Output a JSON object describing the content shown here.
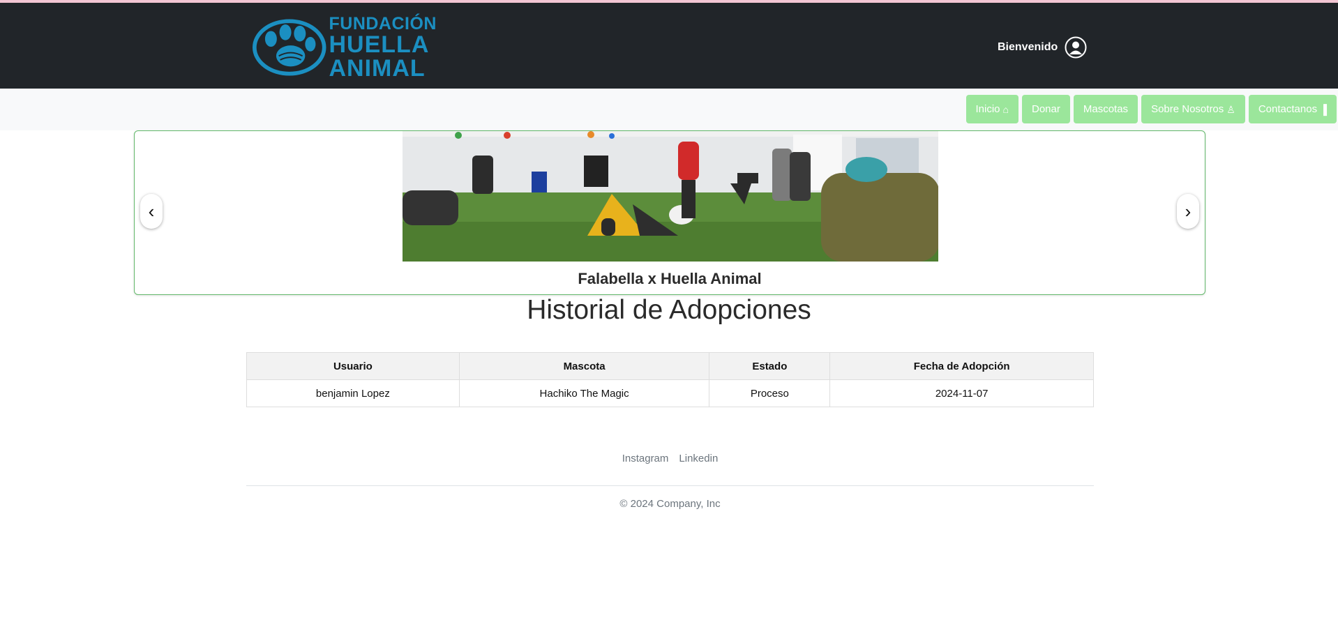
{
  "brand": {
    "logo_line1": "FUNDACIÓN",
    "logo_line2": "HUELLA",
    "logo_line3": "ANIMAL",
    "color": "#1b8fc1"
  },
  "header": {
    "welcome_text": "Bienvenido",
    "user_icon": "user-circle-icon"
  },
  "nav": {
    "button_color": "#9be69b",
    "items": [
      {
        "label": "Inicio",
        "icon": "home-icon",
        "glyph": "⌂"
      },
      {
        "label": "Donar",
        "icon": "",
        "glyph": ""
      },
      {
        "label": "Mascotas",
        "icon": "",
        "glyph": ""
      },
      {
        "label": "Sobre Nosotros",
        "icon": "person-icon",
        "glyph": "♙"
      },
      {
        "label": "Contactanos",
        "icon": "book-icon",
        "glyph": "▐"
      }
    ]
  },
  "carousel": {
    "caption": "Falabella x Huella Animal",
    "prev_glyph": "‹",
    "next_glyph": "›"
  },
  "page": {
    "title": "Historial de Adopciones"
  },
  "table": {
    "headers": [
      "Usuario",
      "Mascota",
      "Estado",
      "Fecha de Adopción"
    ],
    "rows": [
      [
        "benjamin Lopez",
        "Hachiko The Magic",
        "Proceso",
        "2024-11-07"
      ]
    ]
  },
  "footer": {
    "links": [
      "Instagram",
      "Linkedin"
    ],
    "copyright": "© 2024 Company, Inc"
  }
}
